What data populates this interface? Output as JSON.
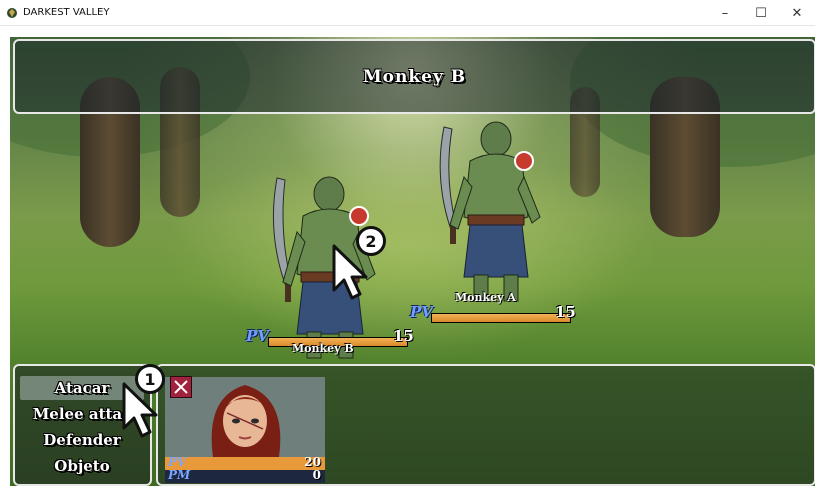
{
  "window": {
    "title": "DARKEST VALLEY",
    "controls": {
      "minimize": "–",
      "maximize": "☐",
      "close": "✕"
    }
  },
  "enemy_window": {
    "title": "Monkey  B"
  },
  "enemies": [
    {
      "name": "Monkey  A",
      "hp_key": "PV",
      "hp_value": "15",
      "hp_fraction": 1.0
    },
    {
      "name": "Monkey  B",
      "hp_key": "PV",
      "hp_value": "15",
      "hp_fraction": 1.0
    }
  ],
  "commands": [
    {
      "label": "Atacar",
      "selected": true
    },
    {
      "label": "Melee attac",
      "selected": false
    },
    {
      "label": "Defender",
      "selected": false
    },
    {
      "label": "Objeto",
      "selected": false
    }
  ],
  "actor": {
    "state_icon": "crossed-sword-icon",
    "hp_key": "PV",
    "hp_value": "20",
    "hp_fraction": 1.0,
    "mp_key": "PM",
    "mp_value": "0",
    "mp_fraction": 0.0
  },
  "annotations": [
    {
      "label": "1",
      "icon": "mouse-pointer-icon"
    },
    {
      "label": "2",
      "icon": "mouse-pointer-icon"
    }
  ],
  "colors": {
    "hp_fill": "#e89a3a",
    "mp_fill": "#1d2740",
    "stat_key": "#6fa0ff",
    "state_icon_bg": "#a0223c"
  }
}
